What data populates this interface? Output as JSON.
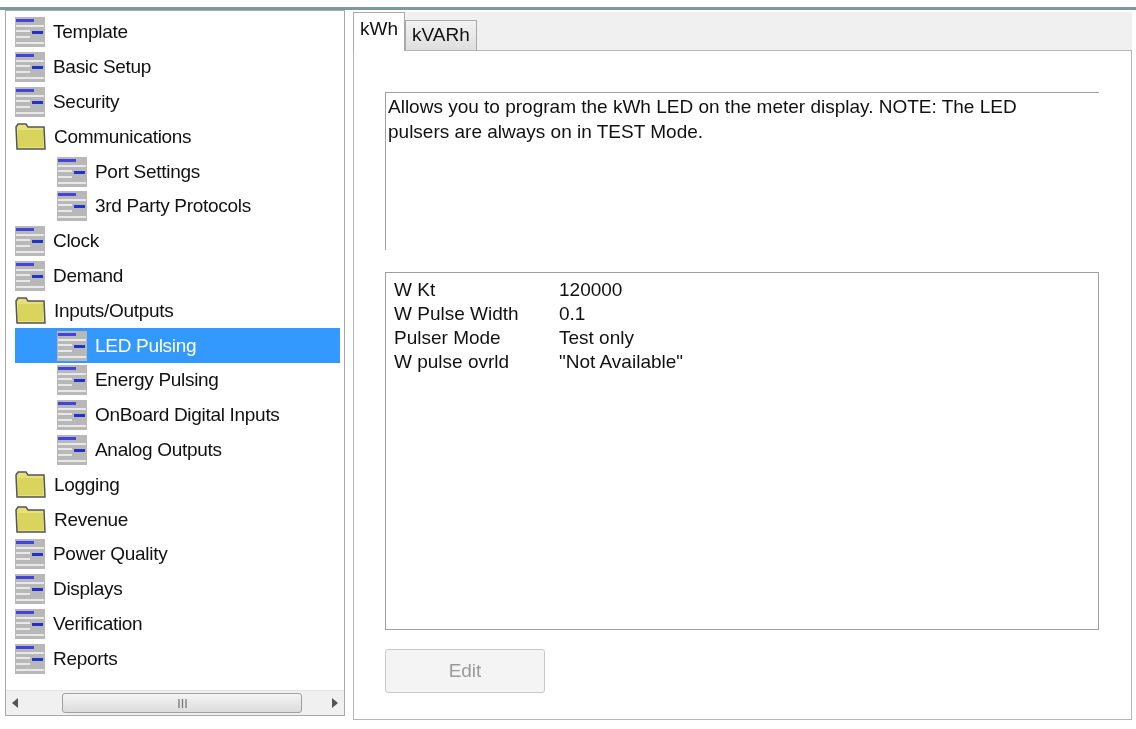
{
  "tree": {
    "items": [
      {
        "label": "Template",
        "kind": "page",
        "selected": false
      },
      {
        "label": "Basic Setup",
        "kind": "page",
        "selected": false
      },
      {
        "label": "Security",
        "kind": "page",
        "selected": false
      },
      {
        "label": "Communications",
        "kind": "folder",
        "selected": false,
        "children": [
          {
            "label": "Port Settings",
            "kind": "page",
            "selected": false
          },
          {
            "label": "3rd Party Protocols",
            "kind": "page",
            "selected": false
          }
        ]
      },
      {
        "label": "Clock",
        "kind": "page",
        "selected": false
      },
      {
        "label": "Demand",
        "kind": "page",
        "selected": false
      },
      {
        "label": "Inputs/Outputs",
        "kind": "folder",
        "selected": false,
        "children": [
          {
            "label": "LED Pulsing",
            "kind": "page",
            "selected": true
          },
          {
            "label": "Energy Pulsing",
            "kind": "page",
            "selected": false
          },
          {
            "label": "OnBoard Digital Inputs",
            "kind": "page",
            "selected": false
          },
          {
            "label": "Analog Outputs",
            "kind": "page",
            "selected": false
          }
        ]
      },
      {
        "label": "Logging",
        "kind": "folder",
        "selected": false
      },
      {
        "label": "Revenue",
        "kind": "folder",
        "selected": false
      },
      {
        "label": "Power Quality",
        "kind": "page",
        "selected": false
      },
      {
        "label": "Displays",
        "kind": "page",
        "selected": false
      },
      {
        "label": "Verification",
        "kind": "page",
        "selected": false
      },
      {
        "label": "Reports",
        "kind": "page",
        "selected": false
      }
    ]
  },
  "tabs": [
    {
      "label": "kWh",
      "selected": true
    },
    {
      "label": "kVARh",
      "selected": false
    }
  ],
  "description": "Allows you to program the kWh LED on the meter display. NOTE: The LED pulsers are always on in TEST Mode.",
  "settings": [
    {
      "name": "W Kt",
      "value": "120000"
    },
    {
      "name": "W Pulse Width",
      "value": "0.1"
    },
    {
      "name": "Pulser Mode",
      "value": "Test only"
    },
    {
      "name": "W pulse ovrld",
      "value": "\"Not Available\""
    }
  ],
  "edit_button": {
    "label": "Edit",
    "disabled": true
  }
}
